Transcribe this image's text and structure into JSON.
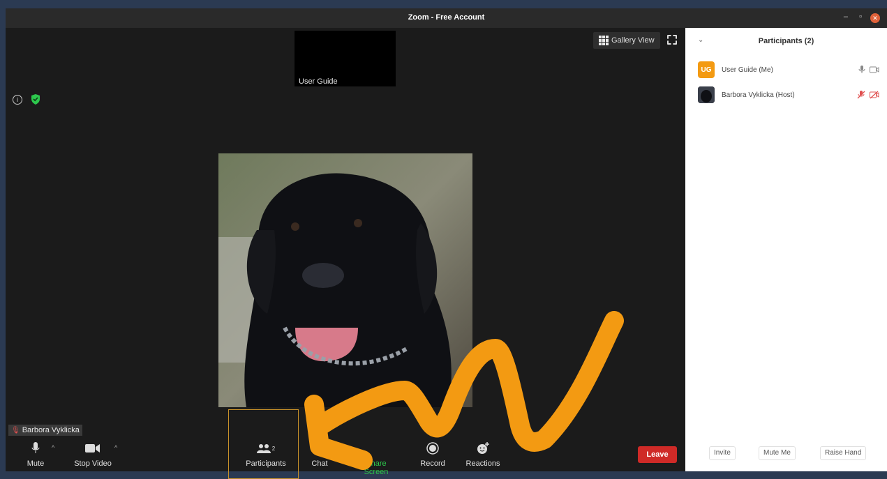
{
  "window": {
    "title": "Zoom - Free Account"
  },
  "thumbnail": {
    "label": "User Guide"
  },
  "gallery": {
    "label": "Gallery View"
  },
  "video": {
    "name_tag": "Barbora Vyklicka"
  },
  "toolbar": {
    "mute": "Mute",
    "stop_video": "Stop Video",
    "participants": "Participants",
    "participants_count": "2",
    "chat": "Chat",
    "share_screen": "Share Screen",
    "record": "Record",
    "reactions": "Reactions",
    "leave": "Leave"
  },
  "panel": {
    "title": "Participants (2)",
    "participants": [
      {
        "initials": "UG",
        "name": "User Guide (Me)"
      },
      {
        "initials": "",
        "name": "Barbora Vyklicka (Host)"
      }
    ],
    "buttons": {
      "invite": "Invite",
      "mute_me": "Mute Me",
      "raise_hand": "Raise Hand"
    }
  },
  "colors": {
    "accent": "#f39a12",
    "leave": "#cf2a27",
    "share": "#2dc84d"
  }
}
